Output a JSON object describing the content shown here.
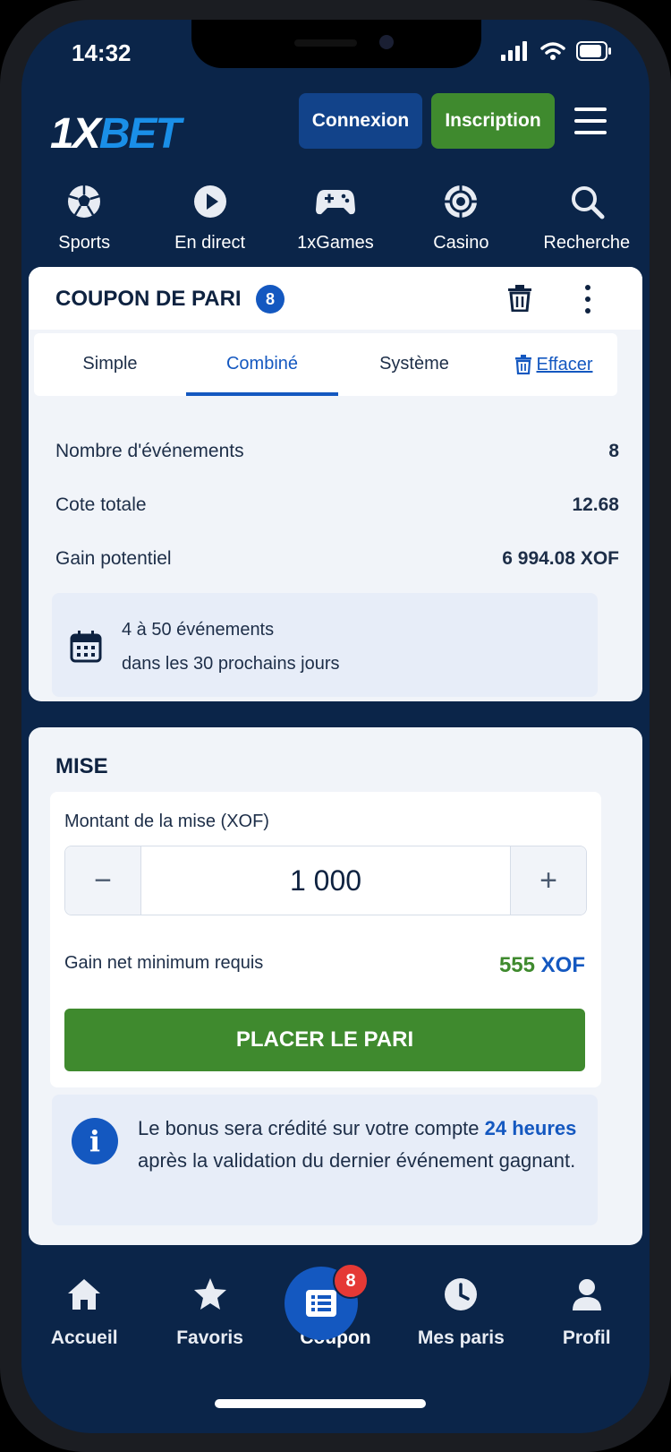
{
  "status_bar": {
    "time": "14:32"
  },
  "header": {
    "logo_part1": "1X",
    "logo_part2": "BET",
    "login_label": "Connexion",
    "signup_label": "Inscription"
  },
  "top_nav": [
    {
      "label": "Sports",
      "icon": "soccer-ball-icon"
    },
    {
      "label": "En direct",
      "icon": "play-icon"
    },
    {
      "label": "1xGames",
      "icon": "gamepad-icon"
    },
    {
      "label": "Casino",
      "icon": "casino-chip-icon"
    },
    {
      "label": "Recherche",
      "icon": "search-icon"
    }
  ],
  "coupon": {
    "title": "COUPON DE PARI",
    "count": "8",
    "tabs": [
      "Simple",
      "Combiné",
      "Système"
    ],
    "active_tab": "Combiné",
    "clear_label": "Effacer",
    "rows": [
      {
        "label": "Nombre d'événements",
        "value": "8"
      },
      {
        "label": "Cote totale",
        "value": "12.68"
      },
      {
        "label": "Gain potentiel",
        "value": "6 994.08 XOF"
      }
    ],
    "note_line1": "4 à 50 événements",
    "note_line2": "dans les 30 prochains jours"
  },
  "stake": {
    "title": "MISE",
    "amount_label": "Montant de la mise (XOF)",
    "amount_value": "1 000",
    "minus_label": "−",
    "plus_label": "+",
    "min_gain_label": "Gain net minimum requis",
    "min_gain_amount": "555",
    "min_gain_currency": "XOF",
    "place_bet_label": "PLACER LE PARI"
  },
  "bonus": {
    "text_before": "Le bonus sera crédité sur votre compte ",
    "highlight": "24 heures",
    "text_after": " après la validation du dernier événement gagnant."
  },
  "bottom_nav": [
    {
      "label": "Accueil",
      "icon": "home-icon"
    },
    {
      "label": "Favoris",
      "icon": "star-icon"
    },
    {
      "label": "Coupon",
      "icon": "coupon-icon",
      "badge": "8"
    },
    {
      "label": "Mes paris",
      "icon": "clock-icon"
    },
    {
      "label": "Profil",
      "icon": "person-icon"
    }
  ],
  "colors": {
    "background": "#0b2549",
    "accent_blue": "#1458c0",
    "accent_green": "#3f8a2e",
    "badge_red": "#e53935"
  }
}
